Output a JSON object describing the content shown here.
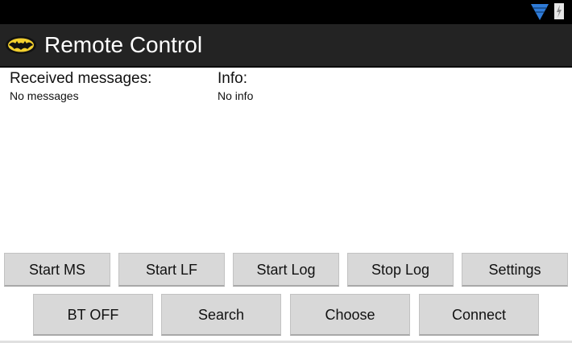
{
  "status_bar": {
    "icons": [
      "wifi-icon",
      "battery-charging-icon"
    ],
    "wifi_color": "#2f7bd8"
  },
  "action_bar": {
    "app_icon": "bat-logo-icon",
    "title": "Remote Control",
    "background_color": "#232323"
  },
  "received": {
    "label": "Received messages:",
    "value": "No messages"
  },
  "info": {
    "label": "Info:",
    "value": "No info"
  },
  "buttons": {
    "row1": [
      "Start MS",
      "Start LF",
      "Start Log",
      "Stop Log",
      "Settings"
    ],
    "row2": [
      "BT OFF",
      "Search",
      "Choose",
      "Connect"
    ]
  }
}
